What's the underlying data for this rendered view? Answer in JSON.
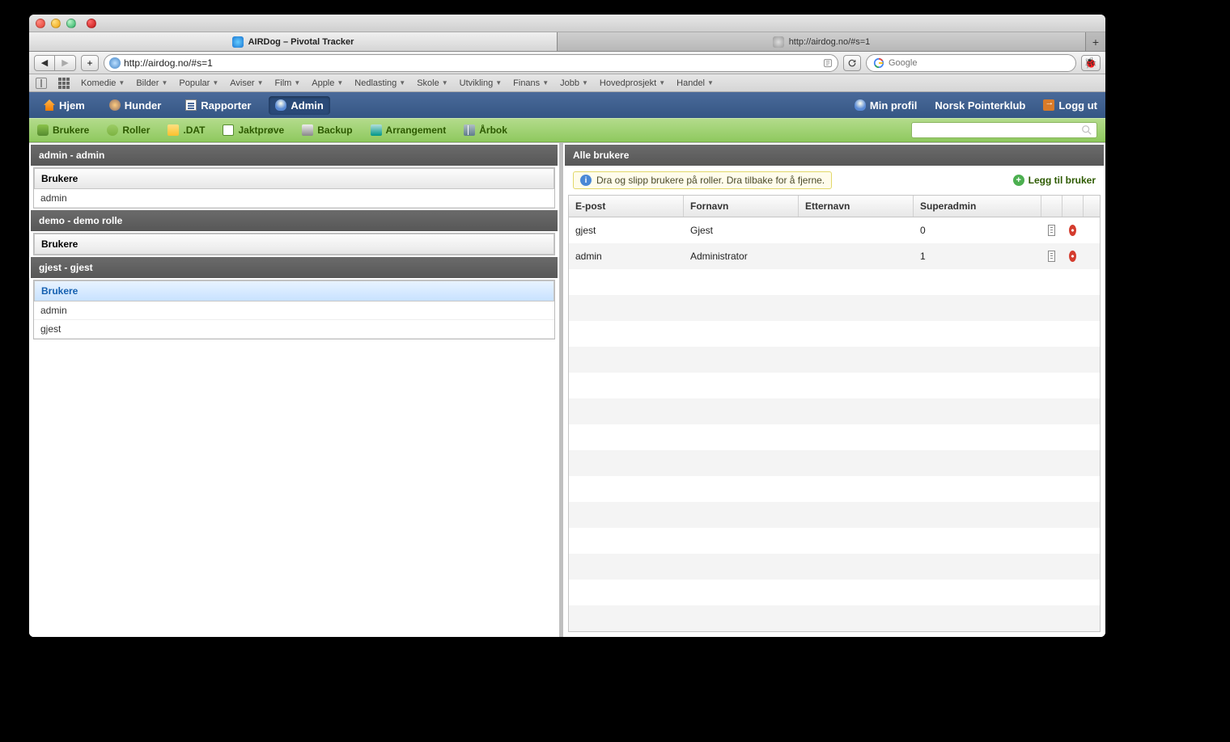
{
  "window": {
    "tabs": [
      {
        "title": "AIRDog – Pivotal Tracker"
      },
      {
        "title": "http://airdog.no/#s=1"
      }
    ],
    "tab_plus_aria": "New tab"
  },
  "toolbar": {
    "back_aria": "Back",
    "forward_aria": "Forward",
    "reload_aria": "Reload",
    "url": "http://airdog.no/#s=1",
    "reader_aria": "Reader",
    "search_placeholder": "Google",
    "overflow_aria": "More"
  },
  "bookmarks": [
    "Komedie",
    "Bilder",
    "Popular",
    "Aviser",
    "Film",
    "Apple",
    "Nedlasting",
    "Skole",
    "Utvikling",
    "Finans",
    "Jobb",
    "Hovedprosjekt",
    "Handel"
  ],
  "appnav": {
    "left": [
      {
        "label": "Hjem",
        "icon": "home-icon"
      },
      {
        "label": "Hunder",
        "icon": "dog-icon"
      },
      {
        "label": "Rapporter",
        "icon": "report-icon"
      },
      {
        "label": "Admin",
        "icon": "user-icon",
        "active": true
      }
    ],
    "right": [
      {
        "label": "Min profil",
        "icon": "user-icon"
      },
      {
        "label": "Norsk Pointerklub"
      },
      {
        "label": "Logg ut",
        "icon": "logout-icon"
      }
    ]
  },
  "subnav": {
    "items": [
      {
        "label": "Brukere",
        "icon": "users-icon"
      },
      {
        "label": "Roller",
        "icon": "roles-icon"
      },
      {
        "label": ".DAT",
        "icon": "file-icon"
      },
      {
        "label": "Jaktprøve",
        "icon": "doc-icon"
      },
      {
        "label": "Backup",
        "icon": "disk-icon"
      },
      {
        "label": "Arrangement",
        "icon": "event-icon"
      },
      {
        "label": "Årbok",
        "icon": "book-icon"
      }
    ],
    "search_aria": "Search"
  },
  "left_panels": [
    {
      "title": "admin - admin",
      "header": "Brukere",
      "selected": false,
      "items": [
        "admin"
      ]
    },
    {
      "title": "demo - demo rolle",
      "header": "Brukere",
      "selected": false,
      "items": []
    },
    {
      "title": "gjest - gjest",
      "header": "Brukere",
      "selected": true,
      "items": [
        "admin",
        "gjest"
      ]
    }
  ],
  "right_panel": {
    "title": "Alle brukere",
    "notice": "Dra og slipp brukere på roller. Dra tilbake for å fjerne.",
    "add_user": "Legg til bruker",
    "columns": [
      "E-post",
      "Fornavn",
      "Etternavn",
      "Superadmin"
    ],
    "rows": [
      {
        "epost": "gjest",
        "fornavn": "Gjest",
        "etternavn": "",
        "superadmin": "0"
      },
      {
        "epost": "admin",
        "fornavn": "Administrator",
        "etternavn": "",
        "superadmin": "1"
      }
    ],
    "empty_rows": 14
  }
}
